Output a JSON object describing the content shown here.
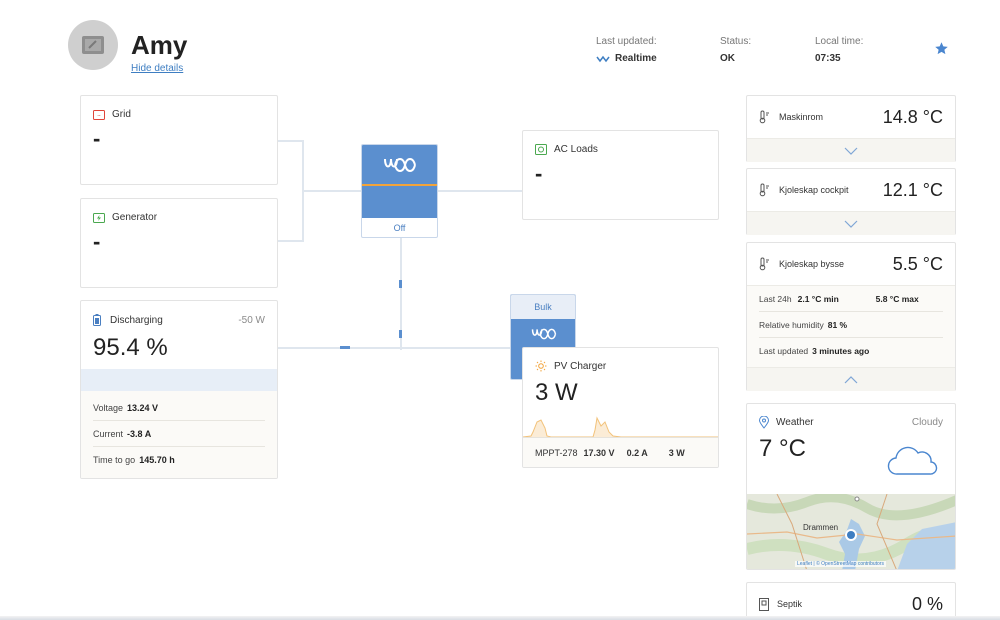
{
  "header": {
    "site_name": "Amy",
    "hide_details": "Hide details",
    "last_updated_label": "Last updated:",
    "last_updated_value": "Realtime",
    "status_label": "Status:",
    "status_value": "OK",
    "local_time_label": "Local time:",
    "local_time_value": "07:35"
  },
  "grid": {
    "title": "Grid",
    "value": "-"
  },
  "generator": {
    "title": "Generator",
    "value": "-"
  },
  "ac_loads": {
    "title": "AC Loads",
    "value": "-"
  },
  "inverter": {
    "state": "Off"
  },
  "mppt": {
    "state": "Bulk"
  },
  "battery": {
    "state": "Discharging",
    "power": "-50 W",
    "soc": "95.4 %",
    "voltage_label": "Voltage",
    "voltage_value": "13.24 V",
    "current_label": "Current",
    "current_value": "-3.8 A",
    "time_label": "Time to go",
    "time_value": "145.70 h"
  },
  "pv": {
    "title": "PV Charger",
    "value": "3 W",
    "device": "MPPT-278",
    "voltage": "17.30 V",
    "current": "0.2 A",
    "power": "3 W"
  },
  "sensors": {
    "maskinrom": {
      "name": "Maskinrom",
      "value": "14.8 °C"
    },
    "cockpit": {
      "name": "Kjoleskap cockpit",
      "value": "12.1 °C"
    },
    "bysse": {
      "name": "Kjoleskap bysse",
      "value": "5.5 °C",
      "last24_label": "Last 24h",
      "min": "2.1 °C min",
      "max": "5.8 °C max",
      "humidity_label": "Relative humidity",
      "humidity_value": "81 %",
      "updated_label": "Last updated",
      "updated_value": "3 minutes ago"
    }
  },
  "weather": {
    "title": "Weather",
    "condition": "Cloudy",
    "temperature": "7 °C",
    "map_city": "Drammen",
    "map_credit": "Leaflet | © OpenStreetMap contributors"
  },
  "septik": {
    "name": "Septik",
    "value": "0 %"
  },
  "colors": {
    "accent_blue": "#5b8fcf",
    "orange": "#f2a33a",
    "grid_red": "#e0453a",
    "generator_green": "#4aa84f"
  }
}
